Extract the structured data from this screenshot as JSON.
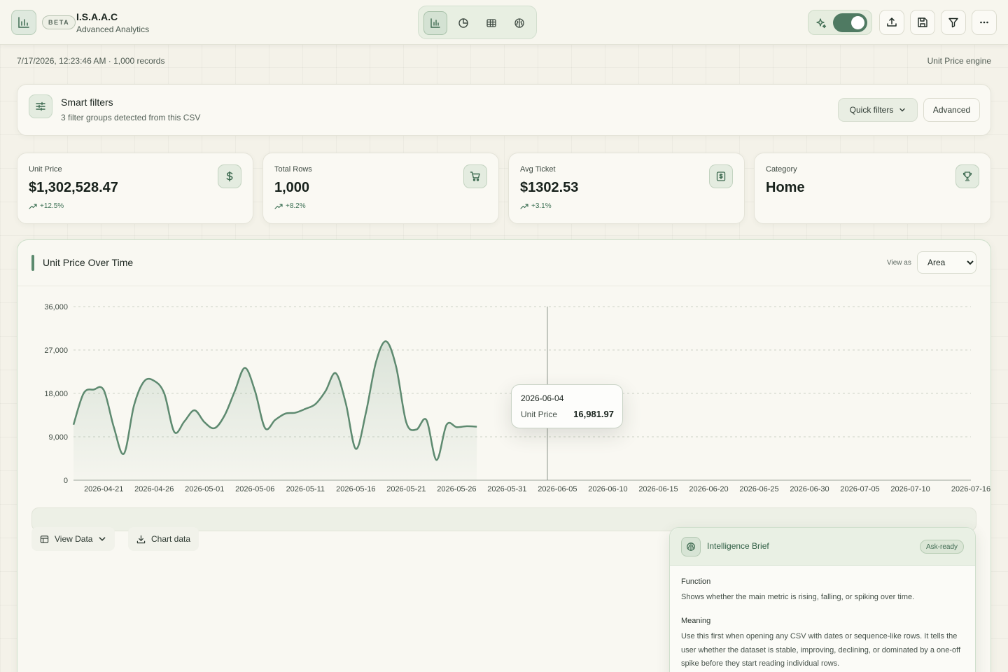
{
  "app": {
    "badge": "BETA",
    "title": "I.S.A.A.C",
    "subtitle": "Advanced Analytics"
  },
  "topbar": {
    "views": [
      "bar-chart-icon",
      "pie-chart-icon",
      "table-icon",
      "brain-icon"
    ],
    "active_view": 0,
    "ai_toggle_on": true
  },
  "meta": {
    "timestamp_records": "7/17/2026, 12:23:46 AM · 1,000 records",
    "engine": "Unit Price engine"
  },
  "smart_filters": {
    "title": "Smart filters",
    "subtitle": "3 filter groups detected from this CSV",
    "quick_label": "Quick filters",
    "advanced_label": "Advanced"
  },
  "kpis": [
    {
      "label": "Unit Price",
      "value": "$1,302,528.47",
      "delta": "+12.5%",
      "icon": "dollar-icon"
    },
    {
      "label": "Total Rows",
      "value": "1,000",
      "delta": "+8.2%",
      "icon": "cart-icon"
    },
    {
      "label": "Avg Ticket",
      "value": "$1302.53",
      "delta": "+3.1%",
      "icon": "receipt-icon"
    },
    {
      "label": "Category",
      "value": "Home",
      "delta": "",
      "icon": "trophy-icon"
    }
  ],
  "chart_panel": {
    "title": "Unit Price Over Time",
    "view_as_label": "View as",
    "view_as_value": "Area",
    "view_as_options": [
      "Area"
    ],
    "view_data_label": "View Data",
    "chart_data_label": "Chart data",
    "tooltip": {
      "date": "2026-06-04",
      "series": "Unit Price",
      "value": "16,981.97"
    }
  },
  "chart_data": {
    "type": "area",
    "title": "Unit Price Over Time",
    "xlabel": "",
    "ylabel": "",
    "ylim": [
      0,
      36000
    ],
    "yticks": [
      "0",
      "9,000",
      "18,000",
      "27,000",
      "36,000"
    ],
    "xticks": [
      "2026-04-21",
      "2026-04-26",
      "2026-05-01",
      "2026-05-06",
      "2026-05-11",
      "2026-05-16",
      "2026-05-21",
      "2026-05-26",
      "2026-05-31",
      "2026-06-05",
      "2026-06-10",
      "2026-06-15",
      "2026-06-20",
      "2026-06-25",
      "2026-06-30",
      "2026-07-05",
      "2026-07-10",
      "2026-07-16"
    ],
    "x_range": [
      "2026-04-18",
      "2026-07-16"
    ],
    "grid": true,
    "cursor_date": "2026-06-04",
    "series": [
      {
        "color": "#5e8a70",
        "points": [
          [
            "2026-04-18",
            11500
          ],
          [
            "2026-04-19",
            18000
          ],
          [
            "2026-04-20",
            18800
          ],
          [
            "2026-04-21",
            18700
          ],
          [
            "2026-04-22",
            11000
          ],
          [
            "2026-04-23",
            5500
          ],
          [
            "2026-04-24",
            15500
          ],
          [
            "2026-04-25",
            20500
          ],
          [
            "2026-04-26",
            20600
          ],
          [
            "2026-04-27",
            18000
          ],
          [
            "2026-04-28",
            10000
          ],
          [
            "2026-04-29",
            12200
          ],
          [
            "2026-04-30",
            14500
          ],
          [
            "2026-05-01",
            12000
          ],
          [
            "2026-05-02",
            10800
          ],
          [
            "2026-05-03",
            13500
          ],
          [
            "2026-05-04",
            18500
          ],
          [
            "2026-05-05",
            23300
          ],
          [
            "2026-05-06",
            18500
          ],
          [
            "2026-05-07",
            10800
          ],
          [
            "2026-05-08",
            12500
          ],
          [
            "2026-05-09",
            13800
          ],
          [
            "2026-05-10",
            14000
          ],
          [
            "2026-05-11",
            14800
          ],
          [
            "2026-05-12",
            15800
          ],
          [
            "2026-05-13",
            18500
          ],
          [
            "2026-05-14",
            22200
          ],
          [
            "2026-05-15",
            16000
          ],
          [
            "2026-05-16",
            6500
          ],
          [
            "2026-05-17",
            14000
          ],
          [
            "2026-05-18",
            24500
          ],
          [
            "2026-05-19",
            28800
          ],
          [
            "2026-05-20",
            23500
          ],
          [
            "2026-05-21",
            12000
          ],
          [
            "2026-05-22",
            10500
          ],
          [
            "2026-05-23",
            12500
          ],
          [
            "2026-05-24",
            4200
          ],
          [
            "2026-05-25",
            11500
          ],
          [
            "2026-05-26",
            11000
          ],
          [
            "2026-05-27",
            11200
          ],
          [
            "2026-05-28",
            11100
          ]
        ]
      }
    ]
  },
  "brief": {
    "title": "Intelligence Brief",
    "badge": "Ask-ready",
    "function_title": "Function",
    "function_text": "Shows whether the main metric is rising, falling, or spiking over time.",
    "meaning_title": "Meaning",
    "meaning_text": "Use this first when opening any CSV with dates or sequence-like rows. It tells the user whether the dataset is stable, improving, declining, or dominated by a one-off spike before they start reading individual rows."
  }
}
